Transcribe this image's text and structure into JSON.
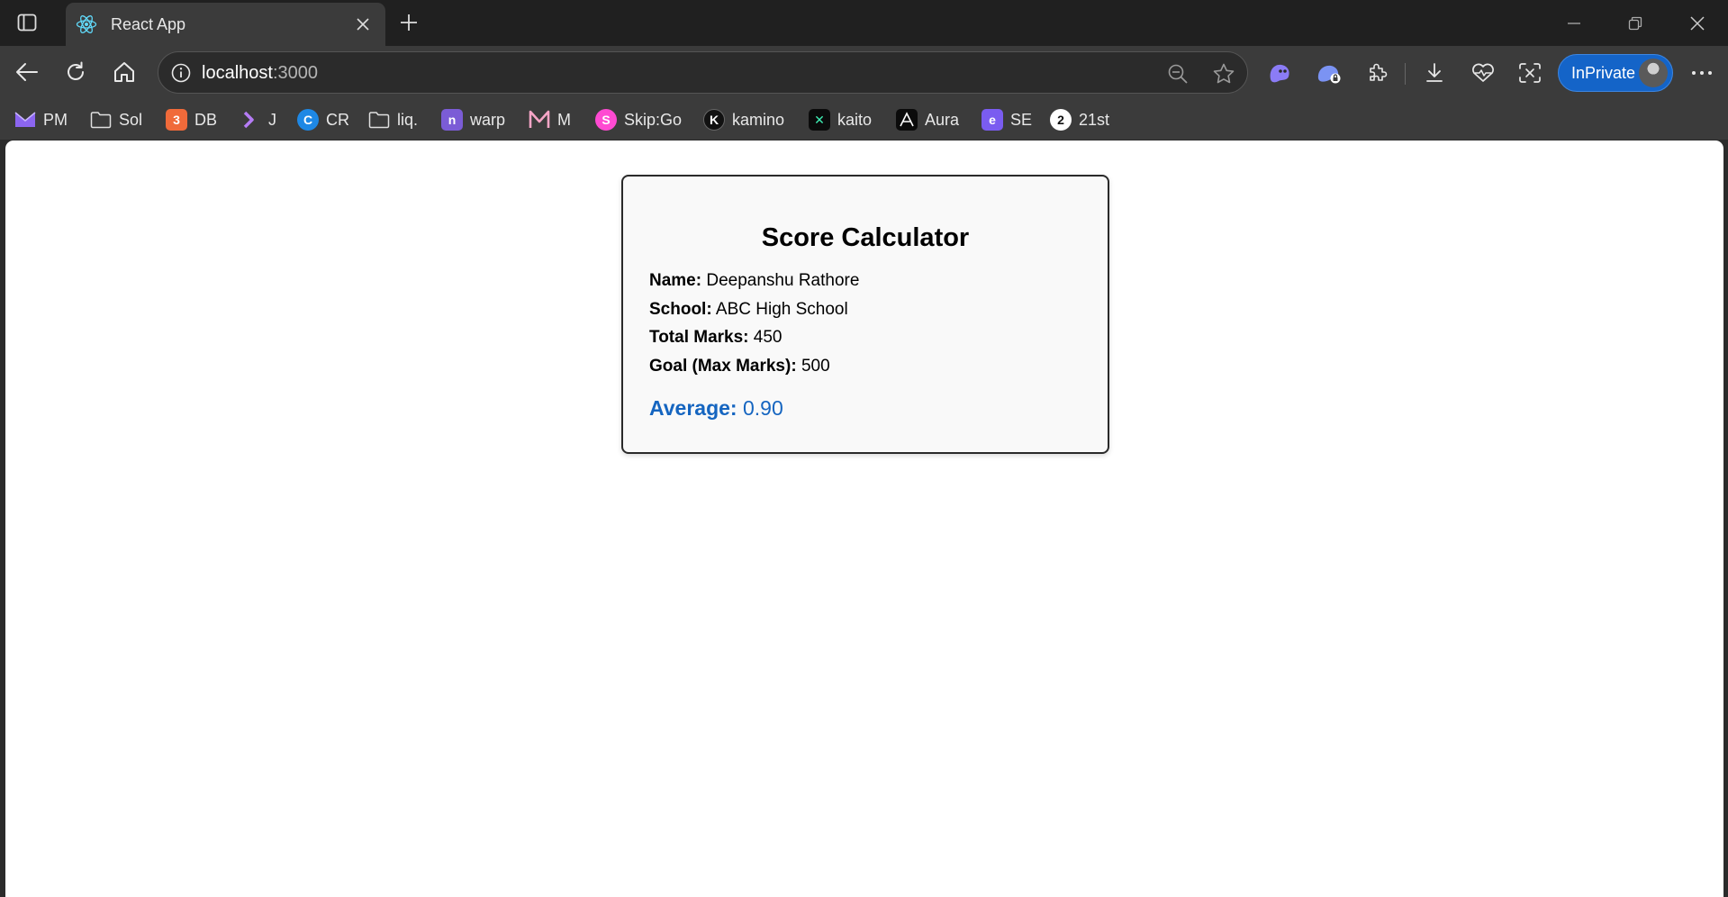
{
  "browser": {
    "tab": {
      "title": "React App"
    },
    "address": {
      "host": "localhost",
      "port": ":3000"
    },
    "profile": {
      "label": "InPrivate"
    },
    "colors": {
      "accent": "#1464c8",
      "tab_bg": "#3b3b3b",
      "frame_bg": "#202020"
    }
  },
  "bookmarks": [
    {
      "label": "PM",
      "icon": "proton-mail-icon"
    },
    {
      "label": "Sol",
      "icon": "folder-icon"
    },
    {
      "label": "DB",
      "icon": "db-icon"
    },
    {
      "label": "J",
      "icon": "jira-icon"
    },
    {
      "label": "CR",
      "icon": "cr-icon"
    },
    {
      "label": "liq.",
      "icon": "folder-icon"
    },
    {
      "label": "warp",
      "icon": "warp-icon"
    },
    {
      "label": "M",
      "icon": "m-icon"
    },
    {
      "label": "Skip:Go",
      "icon": "skip-go-icon"
    },
    {
      "label": "kamino",
      "icon": "kamino-icon"
    },
    {
      "label": "kaito",
      "icon": "kaito-icon"
    },
    {
      "label": "Aura",
      "icon": "aura-icon"
    },
    {
      "label": "SE",
      "icon": "se-icon"
    },
    {
      "label": "21st",
      "icon": "21st-icon"
    }
  ],
  "card": {
    "title": "Score Calculator",
    "fields": [
      {
        "label": "Name:",
        "value": "Deepanshu Rathore"
      },
      {
        "label": "School:",
        "value": "ABC High School"
      },
      {
        "label": "Total Marks:",
        "value": "450"
      },
      {
        "label": "Goal (Max Marks):",
        "value": "500"
      }
    ],
    "average": {
      "label": "Average:",
      "value": "0.90"
    },
    "colors": {
      "average": "#1565c0"
    }
  }
}
